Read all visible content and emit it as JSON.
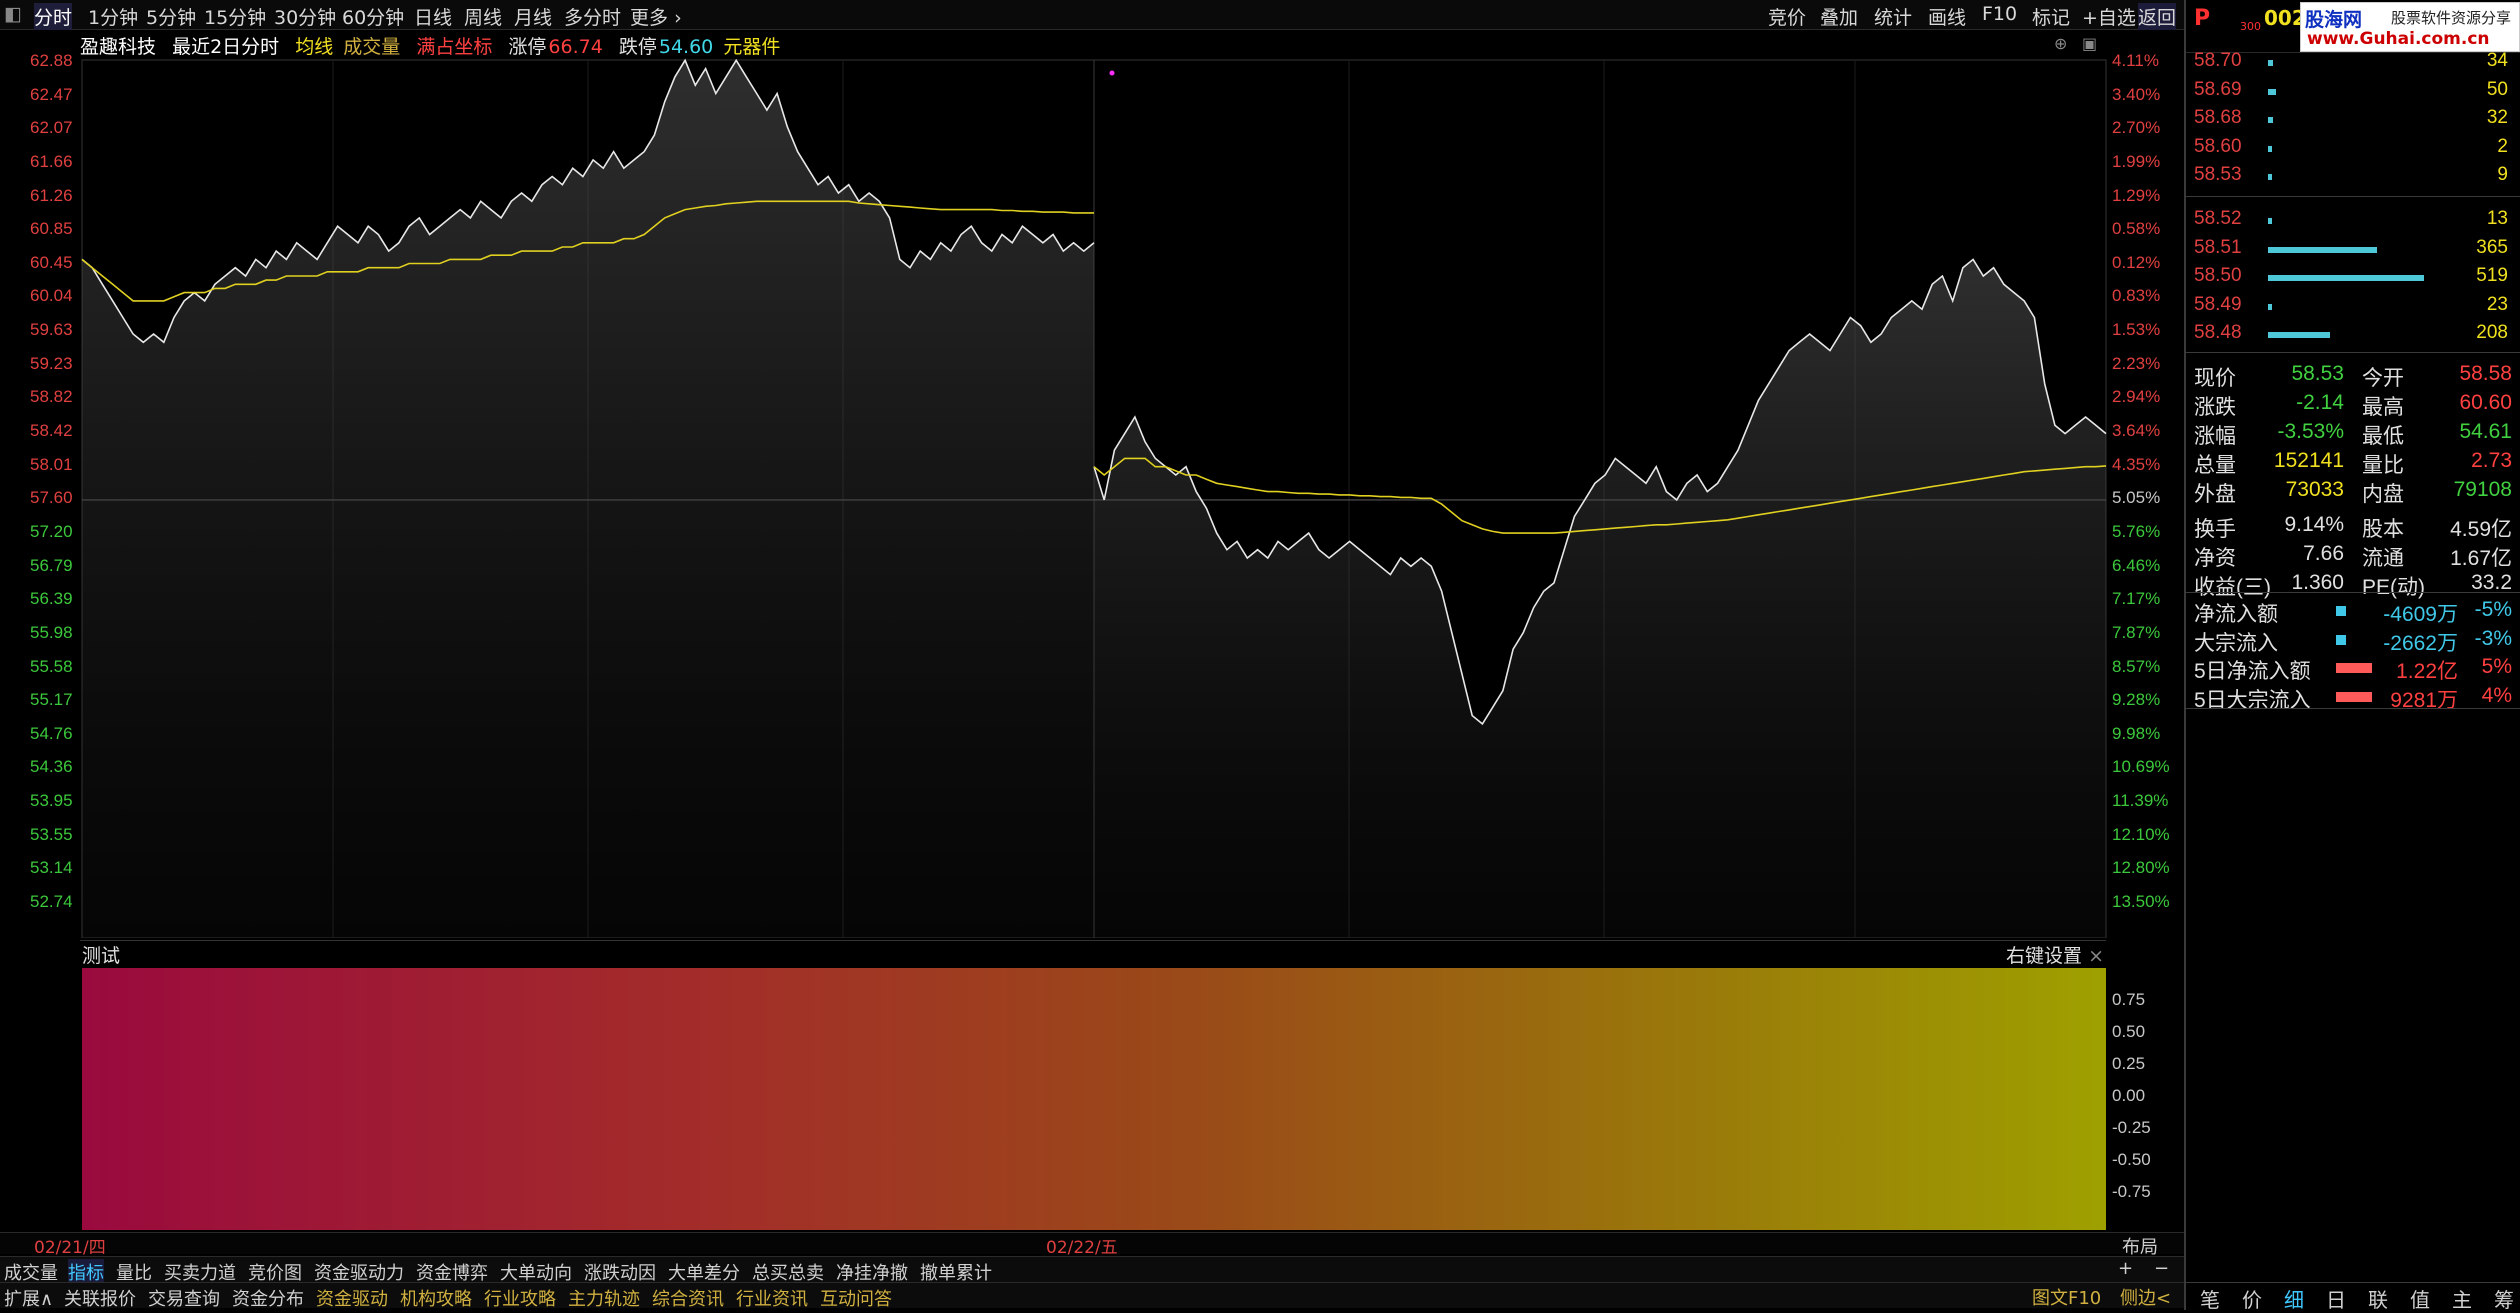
{
  "toptabs": [
    "分时",
    "1分钟",
    "5分钟",
    "15分钟",
    "30分钟",
    "60分钟",
    "日线",
    "周线",
    "月线",
    "多分时",
    "更多"
  ],
  "toptabs_right": [
    "竞价",
    "叠加",
    "统计",
    "画线",
    "F10",
    "标记",
    "+自选",
    "返回"
  ],
  "info": {
    "name": "盈趣科技",
    "period": "最近2日分时",
    "avg_line": "均线",
    "volume": "成交量",
    "full_coord": "满占坐标",
    "limit_up_label": "涨停",
    "limit_up": "66.74",
    "limit_down_label": "跌停",
    "limit_down": "54.60",
    "sector": "元器件"
  },
  "price_axis": [
    "62.88",
    "62.47",
    "62.07",
    "61.66",
    "61.26",
    "60.85",
    "60.45",
    "60.04",
    "59.63",
    "59.23",
    "58.82",
    "58.42",
    "58.01",
    "57.60",
    "57.20",
    "56.79",
    "56.39",
    "55.98",
    "55.58",
    "55.17",
    "54.76",
    "54.36",
    "53.95",
    "53.55",
    "53.14",
    "52.74"
  ],
  "pct_axis": [
    "4.11%",
    "3.40%",
    "2.70%",
    "1.99%",
    "1.29%",
    "0.58%",
    "0.12%",
    "0.83%",
    "1.53%",
    "2.23%",
    "2.94%",
    "3.64%",
    "4.35%",
    "5.05%",
    "5.76%",
    "6.46%",
    "7.17%",
    "7.87%",
    "8.57%",
    "9.28%",
    "9.98%",
    "10.69%",
    "11.39%",
    "12.10%",
    "12.80%",
    "13.50%"
  ],
  "chart_data": {
    "type": "line",
    "title": "盈趣科技 最近2日分时",
    "xlabel": "",
    "ylabel": "",
    "x_labels": [
      "02/21/四",
      "02/22/五"
    ],
    "ylim": [
      52.74,
      62.88
    ],
    "prev_close": 57.6,
    "series": [
      {
        "name": "价格",
        "day": "02/21/四",
        "values": [
          60.5,
          60.4,
          60.2,
          60.0,
          59.8,
          59.6,
          59.5,
          59.6,
          59.5,
          59.8,
          60.0,
          60.1,
          60.0,
          60.2,
          60.3,
          60.4,
          60.3,
          60.5,
          60.4,
          60.6,
          60.5,
          60.7,
          60.6,
          60.5,
          60.7,
          60.9,
          60.8,
          60.7,
          60.9,
          60.8,
          60.6,
          60.7,
          60.9,
          61.0,
          60.8,
          60.9,
          61.0,
          61.1,
          61.0,
          61.2,
          61.1,
          61.0,
          61.2,
          61.3,
          61.2,
          61.4,
          61.5,
          61.4,
          61.6,
          61.5,
          61.7,
          61.6,
          61.8,
          61.6,
          61.7,
          61.8,
          62.0,
          62.4,
          62.7,
          62.9,
          62.6,
          62.8,
          62.5,
          62.7,
          62.9,
          62.7,
          62.5,
          62.3,
          62.5,
          62.1,
          61.8,
          61.6,
          61.4,
          61.5,
          61.3,
          61.4,
          61.2,
          61.3,
          61.2,
          61.0,
          60.5,
          60.4,
          60.6,
          60.5,
          60.7,
          60.6,
          60.8,
          60.9,
          60.7,
          60.6,
          60.8,
          60.7,
          60.9,
          60.8,
          60.7,
          60.8,
          60.6,
          60.7,
          60.6,
          60.7
        ]
      },
      {
        "name": "均价",
        "day": "02/21/四",
        "values": [
          60.5,
          60.4,
          60.3,
          60.2,
          60.1,
          60.0,
          60.0,
          60.0,
          60.0,
          60.05,
          60.1,
          60.1,
          60.1,
          60.15,
          60.15,
          60.2,
          60.2,
          60.2,
          60.25,
          60.25,
          60.3,
          60.3,
          60.3,
          60.3,
          60.35,
          60.35,
          60.35,
          60.35,
          60.4,
          60.4,
          60.4,
          60.4,
          60.45,
          60.45,
          60.45,
          60.45,
          60.5,
          60.5,
          60.5,
          60.5,
          60.55,
          60.55,
          60.55,
          60.6,
          60.6,
          60.6,
          60.6,
          60.65,
          60.65,
          60.7,
          60.7,
          60.7,
          60.7,
          60.75,
          60.75,
          60.8,
          60.9,
          61.0,
          61.05,
          61.1,
          61.12,
          61.14,
          61.15,
          61.17,
          61.18,
          61.19,
          61.2,
          61.2,
          61.2,
          61.2,
          61.2,
          61.2,
          61.2,
          61.2,
          61.2,
          61.2,
          61.18,
          61.17,
          61.16,
          61.15,
          61.14,
          61.13,
          61.12,
          61.11,
          61.1,
          61.1,
          61.1,
          61.1,
          61.1,
          61.1,
          61.09,
          61.09,
          61.08,
          61.08,
          61.07,
          61.07,
          61.07,
          61.06,
          61.06,
          61.06
        ]
      },
      {
        "name": "价格",
        "day": "02/22/五",
        "values": [
          58.0,
          57.6,
          58.2,
          58.4,
          58.6,
          58.3,
          58.1,
          58.0,
          57.9,
          58.0,
          57.7,
          57.5,
          57.2,
          57.0,
          57.1,
          56.9,
          57.0,
          56.9,
          57.1,
          57.0,
          57.1,
          57.2,
          57.0,
          56.9,
          57.0,
          57.1,
          57.0,
          56.9,
          56.8,
          56.7,
          56.9,
          56.8,
          56.9,
          56.8,
          56.5,
          56.0,
          55.5,
          55.0,
          54.9,
          55.1,
          55.3,
          55.8,
          56.0,
          56.3,
          56.5,
          56.6,
          57.0,
          57.4,
          57.6,
          57.8,
          57.9,
          58.1,
          58.0,
          57.9,
          57.8,
          58.0,
          57.7,
          57.6,
          57.8,
          57.9,
          57.7,
          57.8,
          58.0,
          58.2,
          58.5,
          58.8,
          59.0,
          59.2,
          59.4,
          59.5,
          59.6,
          59.5,
          59.4,
          59.6,
          59.8,
          59.7,
          59.5,
          59.6,
          59.8,
          59.9,
          60.0,
          59.9,
          60.2,
          60.3,
          60.0,
          60.4,
          60.5,
          60.3,
          60.4,
          60.2,
          60.1,
          60.0,
          59.8,
          59.0,
          58.5,
          58.4,
          58.5,
          58.6,
          58.5,
          58.4
        ]
      },
      {
        "name": "均价",
        "day": "02/22/五",
        "values": [
          58.0,
          57.9,
          58.0,
          58.1,
          58.1,
          58.1,
          58.0,
          58.0,
          57.95,
          57.9,
          57.9,
          57.85,
          57.8,
          57.78,
          57.76,
          57.74,
          57.72,
          57.7,
          57.7,
          57.69,
          57.68,
          57.68,
          57.67,
          57.67,
          57.66,
          57.66,
          57.65,
          57.65,
          57.64,
          57.64,
          57.63,
          57.63,
          57.62,
          57.62,
          57.55,
          57.45,
          57.35,
          57.3,
          57.25,
          57.22,
          57.2,
          57.2,
          57.2,
          57.2,
          57.2,
          57.2,
          57.21,
          57.22,
          57.23,
          57.24,
          57.25,
          57.26,
          57.27,
          57.28,
          57.29,
          57.3,
          57.3,
          57.31,
          57.32,
          57.33,
          57.34,
          57.35,
          57.36,
          57.38,
          57.4,
          57.42,
          57.44,
          57.46,
          57.48,
          57.5,
          57.52,
          57.54,
          57.56,
          57.58,
          57.6,
          57.62,
          57.64,
          57.66,
          57.68,
          57.7,
          57.72,
          57.74,
          57.76,
          57.78,
          57.8,
          57.82,
          57.84,
          57.86,
          57.88,
          57.9,
          57.92,
          57.94,
          57.95,
          57.96,
          57.97,
          57.98,
          57.99,
          58.0,
          58.0,
          58.01
        ]
      }
    ],
    "indicator": {
      "name": "测试",
      "yticks": [
        "0.75",
        "0.50",
        "0.25",
        "0.00",
        "-0.25",
        "-0.50",
        "-0.75"
      ],
      "settings_label": "右键设置"
    }
  },
  "bottom_tabs1": [
    "成交量",
    "指标",
    "量比",
    "买卖力道",
    "竞价图",
    "资金驱动力",
    "资金博弈",
    "大单动向",
    "涨跌动因",
    "大单差分",
    "总买总卖",
    "净挂净撤",
    "撤单累计"
  ],
  "bottom_tabs2": [
    "扩展∧",
    "关联报价",
    "交易查询",
    "资金分布",
    "资金驱动",
    "机构攻略",
    "行业攻略",
    "主力轨迹",
    "综合资讯",
    "行业资讯",
    "互动问答"
  ],
  "bottom_right1": "布局",
  "bottom_right2": [
    "图文F10",
    "侧边<"
  ],
  "plus_minus": [
    "+",
    "−"
  ],
  "right_panel": {
    "header_code": "002",
    "header_p": "P",
    "header_sub": "300",
    "logo_name": "股海网",
    "logo_slogan": "股票软件资源分享",
    "logo_url": "www.Guhai.com.cn",
    "asks": [
      {
        "price": "58.70",
        "vol": "34",
        "ratio": 0.03
      },
      {
        "price": "58.69",
        "vol": "50",
        "ratio": 0.05
      },
      {
        "price": "58.68",
        "vol": "32",
        "ratio": 0.03
      },
      {
        "price": "58.60",
        "vol": "2",
        "ratio": 0.01
      },
      {
        "price": "58.53",
        "vol": "9",
        "ratio": 0.01
      }
    ],
    "bids": [
      {
        "price": "58.52",
        "vol": "13",
        "ratio": 0.01
      },
      {
        "price": "58.51",
        "vol": "365",
        "ratio": 0.7
      },
      {
        "price": "58.50",
        "vol": "519",
        "ratio": 1.0
      },
      {
        "price": "58.49",
        "vol": "23",
        "ratio": 0.02
      },
      {
        "price": "58.48",
        "vol": "208",
        "ratio": 0.4
      }
    ],
    "stats": [
      {
        "l1": "现价",
        "v1": "58.53",
        "l2": "今开",
        "v2": "58.58"
      },
      {
        "l1": "涨跌",
        "v1": "-2.14",
        "l2": "最高",
        "v2": "60.60"
      },
      {
        "l1": "涨幅",
        "v1": "-3.53%",
        "l2": "最低",
        "v2": "54.61"
      },
      {
        "l1": "总量",
        "v1": "152141",
        "l2": "量比",
        "v2": "2.73"
      },
      {
        "l1": "外盘",
        "v1": "73033",
        "l2": "内盘",
        "v2": "79108"
      },
      {
        "l1": "换手",
        "v1": "9.14%",
        "l2": "股本",
        "v2": "4.59亿"
      },
      {
        "l1": "净资",
        "v1": "7.66",
        "l2": "流通",
        "v2": "1.67亿"
      },
      {
        "l1": "收益(三)",
        "v1": "1.360",
        "l2": "PE(动)",
        "v2": "33.2"
      }
    ],
    "flows": [
      {
        "label": "净流入额",
        "value": "-4609万",
        "pct": "-5%",
        "dir": "down"
      },
      {
        "label": "大宗流入",
        "value": "-2662万",
        "pct": "-3%",
        "dir": "down"
      },
      {
        "label": "5日净流入额",
        "value": "1.22亿",
        "pct": "5%",
        "dir": "up"
      },
      {
        "label": "5日大宗流入",
        "value": "9281万",
        "pct": "4%",
        "dir": "up"
      }
    ],
    "footer_tabs": [
      "笔",
      "价",
      "细",
      "日",
      "联",
      "值",
      "主",
      "筹"
    ]
  }
}
